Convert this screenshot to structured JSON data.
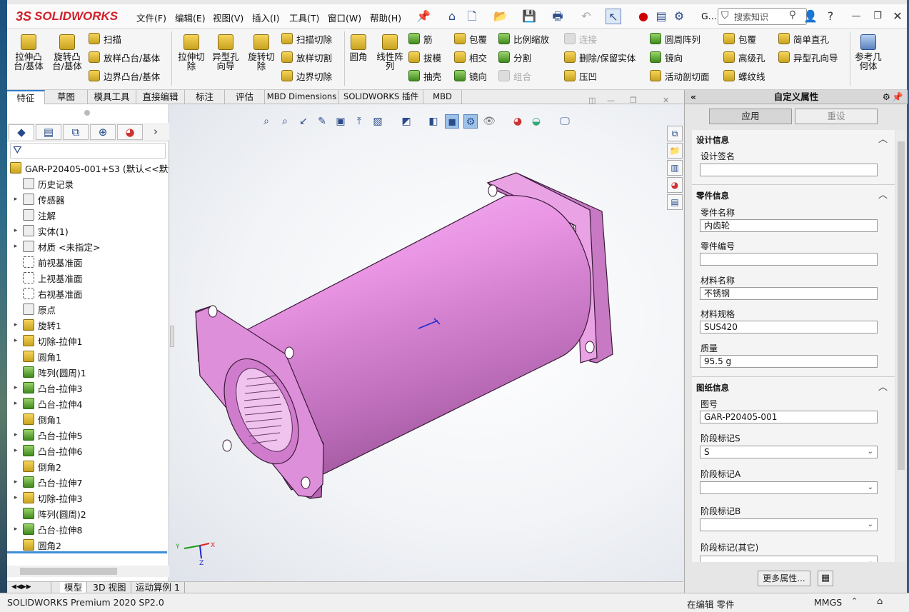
{
  "app": {
    "logo": "SOLIDWORKS",
    "logo_prefix": "3S"
  },
  "menu": [
    "文件(F)",
    "编辑(E)",
    "视图(V)",
    "插入(I)",
    "工具(T)",
    "窗口(W)",
    "帮助(H)"
  ],
  "search_placeholder": "搜索知识",
  "user_initial": "G...",
  "ribbon": {
    "big": [
      "拉伸凸\n台/基体",
      "旋转凸\n台/基体",
      "拉伸切\n除",
      "异型孔\n向导",
      "旋转切\n除",
      "圆角",
      "线性阵\n列",
      "参考几\n何体"
    ],
    "small": [
      "扫描",
      "放样凸台/基体",
      "边界凸台/基体",
      "扫描切除",
      "放样切割",
      "边界切除",
      "筋",
      "拔模",
      "抽壳",
      "包覆",
      "相交",
      "镜向",
      "比例缩放",
      "分割",
      "组合",
      "连接",
      "删除/保留实体",
      "压凹",
      "圆周阵列",
      "镜向",
      "活动剖切面",
      "包覆",
      "高级孔",
      "螺纹线",
      "简单直孔",
      "异型孔向导"
    ]
  },
  "cmd_tabs": [
    "特征",
    "草图",
    "模具工具",
    "直接编辑",
    "标注",
    "评估",
    "MBD Dimensions",
    "SOLIDWORKS 插件",
    "MBD"
  ],
  "tree": {
    "root": "GAR-P20405-001+S3  (默认<<默认",
    "items": [
      "历史记录",
      "传感器",
      "注解",
      "实体(1)",
      "材质 <未指定>",
      "前视基准面",
      "上视基准面",
      "右视基准面",
      "原点",
      "旋转1",
      "切除-拉伸1",
      "圆角1",
      "阵列(圆周)1",
      "凸台-拉伸3",
      "凸台-拉伸4",
      "倒角1",
      "凸台-拉伸5",
      "凸台-拉伸6",
      "倒角2",
      "凸台-拉伸7",
      "切除-拉伸3",
      "阵列(圆周)2",
      "凸台-拉伸8",
      "圆角2"
    ]
  },
  "right_panel": {
    "title": "自定义属性",
    "apply": "应用",
    "reset": "重设",
    "sections": {
      "design": "设计信息",
      "part": "零件信息",
      "drawing": "图纸信息"
    },
    "fields": {
      "design_sign": {
        "label": "设计签名",
        "value": ""
      },
      "part_name": {
        "label": "零件名称",
        "value": "内齿轮"
      },
      "part_no": {
        "label": "零件编号",
        "value": ""
      },
      "material_name": {
        "label": "材料名称",
        "value": "不锈钢"
      },
      "material_spec": {
        "label": "材料规格",
        "value": "SUS420"
      },
      "mass": {
        "label": "质量",
        "value": "95.5 g"
      },
      "drawing_no": {
        "label": "图号",
        "value": "GAR-P20405-001"
      },
      "stage_s": {
        "label": "阶段标记S",
        "value": "S"
      },
      "stage_a": {
        "label": "阶段标记A",
        "value": ""
      },
      "stage_b": {
        "label": "阶段标记B",
        "value": ""
      },
      "stage_other": {
        "label": "阶段标记(其它)",
        "value": ""
      }
    },
    "more": "更多属性..."
  },
  "bottom_tabs": [
    "模型",
    "3D 视图",
    "运动算例 1"
  ],
  "status": {
    "left": "SOLIDWORKS Premium 2020 SP2.0",
    "editing": "在编辑 零件",
    "units": "MMGS"
  },
  "colors": {
    "model": "#e58fe0",
    "accent": "#2f7ccc",
    "logo": "#d2202a"
  }
}
